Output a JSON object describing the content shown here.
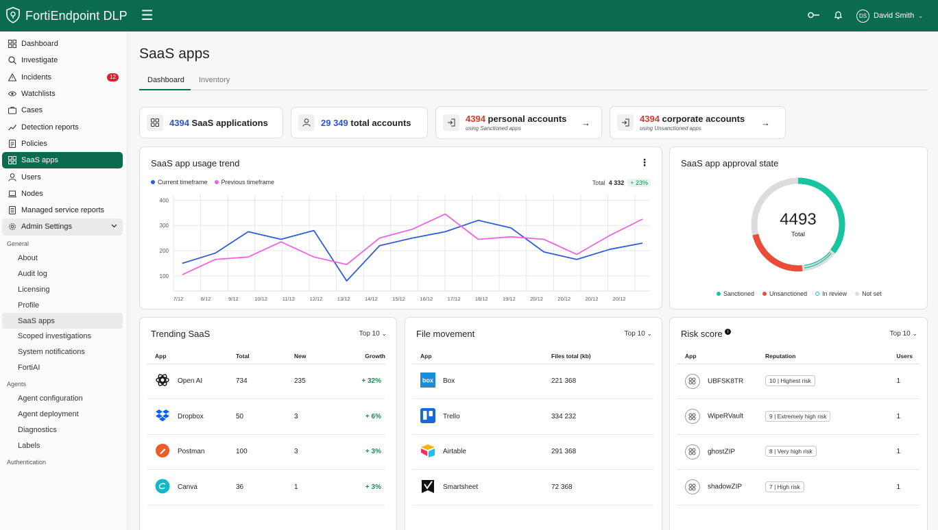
{
  "app": {
    "title": "FortiEndpoint DLP",
    "user_name": "David Smith",
    "user_initials": "DS"
  },
  "sidebar": {
    "items": [
      {
        "label": "Dashboard"
      },
      {
        "label": "Investigate"
      },
      {
        "label": "Incidents",
        "badge": "12"
      },
      {
        "label": "Watchlists"
      },
      {
        "label": "Cases"
      },
      {
        "label": "Detection reports"
      },
      {
        "label": "Policies"
      },
      {
        "label": "SaaS apps"
      },
      {
        "label": "Users"
      },
      {
        "label": "Nodes"
      },
      {
        "label": "Managed service reports"
      },
      {
        "label": "Admin Settings"
      }
    ],
    "general_label": "General",
    "general": [
      "About",
      "Audit log",
      "Licensing",
      "Profile",
      "SaaS apps",
      "Scoped investigations",
      "System notifications",
      "FortiAI"
    ],
    "agents_label": "Agents",
    "agents": [
      "Agent configuration",
      "Agent deployment",
      "Diagnostics",
      "Labels"
    ],
    "auth_label": "Authentication"
  },
  "page": {
    "title": "SaaS apps",
    "tabs": [
      "Dashboard",
      "Inventory"
    ]
  },
  "stats": {
    "apps": {
      "num": "4394",
      "label": " SaaS applications"
    },
    "accounts": {
      "num": "29 349",
      "label": " total accounts"
    },
    "personal": {
      "num": "4394",
      "label": " personal accounts",
      "sub": "using Sanctioned apps"
    },
    "corporate": {
      "num": "4394",
      "label": " corporate accounts",
      "sub": "using Unsanctioned apps"
    }
  },
  "trend": {
    "title": "SaaS app usage trend",
    "legend_current": "Current timeframe",
    "legend_previous": "Previous timeframe",
    "total_label": "Total",
    "total_value": "4 332",
    "growth": "+ 23%"
  },
  "chart_data": {
    "type": "line",
    "x": [
      "7/12",
      "8/12",
      "9/12",
      "10/12",
      "11/12",
      "12/12",
      "13/12",
      "14/12",
      "15/12",
      "16/12",
      "17/12",
      "18/12",
      "19/12",
      "20/12",
      "20/12",
      "20/12",
      "20/12"
    ],
    "series": [
      {
        "name": "Current timeframe",
        "color": "#2f5bd8",
        "values": [
          150,
          190,
          275,
          245,
          280,
          80,
          220,
          250,
          275,
          320,
          290,
          195,
          165,
          205,
          230
        ]
      },
      {
        "name": "Previous timeframe",
        "color": "#ef63e2",
        "values": [
          105,
          165,
          175,
          235,
          175,
          145,
          250,
          285,
          345,
          245,
          255,
          245,
          185,
          260,
          325
        ]
      }
    ],
    "yticks": [
      100,
      200,
      300,
      400
    ],
    "ylim": [
      40,
      420
    ],
    "grid": true
  },
  "approval": {
    "title": "SaaS app approval state",
    "total": "4493",
    "total_label": "Total",
    "legend": [
      "Sanctioned",
      "Unsanctioned",
      "In review",
      "Not set"
    ],
    "colors": [
      "#19c4a0",
      "#ea4c3a",
      "#19c4a0",
      "#dcdcdc"
    ]
  },
  "trending": {
    "title": "Trending SaaS",
    "top": "Top 10",
    "headers": [
      "App",
      "Total",
      "New",
      "Growth"
    ],
    "rows": [
      {
        "app": "Open AI",
        "total": "734",
        "new": "235",
        "growth": "+ 32%"
      },
      {
        "app": "Dropbox",
        "total": "50",
        "new": "3",
        "growth": "+ 6%"
      },
      {
        "app": "Postman",
        "total": "100",
        "new": "3",
        "growth": "+ 3%"
      },
      {
        "app": "Canva",
        "total": "36",
        "new": "1",
        "growth": "+ 3%"
      }
    ]
  },
  "files": {
    "title": "File movement",
    "top": "Top 10",
    "headers": [
      "App",
      "Files total (kb)"
    ],
    "rows": [
      {
        "app": "Box",
        "files": "221 368"
      },
      {
        "app": "Trello",
        "files": "334  232"
      },
      {
        "app": "Airtable",
        "files": "291 368"
      },
      {
        "app": "Smartsheet",
        "files": "72 368"
      }
    ]
  },
  "risk": {
    "title": "Risk score",
    "top": "Top 10",
    "headers": [
      "App",
      "Reputation",
      "Users"
    ],
    "rows": [
      {
        "app": "UBFSK8TR",
        "rep_num": "10",
        "rep": "Highest risk",
        "users": "1"
      },
      {
        "app": "WipeRVault",
        "rep_num": "9",
        "rep": "Extremely high risk",
        "users": "1"
      },
      {
        "app": "ghostZIP",
        "rep_num": "8",
        "rep": "Very high risk",
        "users": "1"
      },
      {
        "app": "shadowZIP",
        "rep_num": "7",
        "rep": "High risk",
        "users": "1"
      }
    ]
  }
}
